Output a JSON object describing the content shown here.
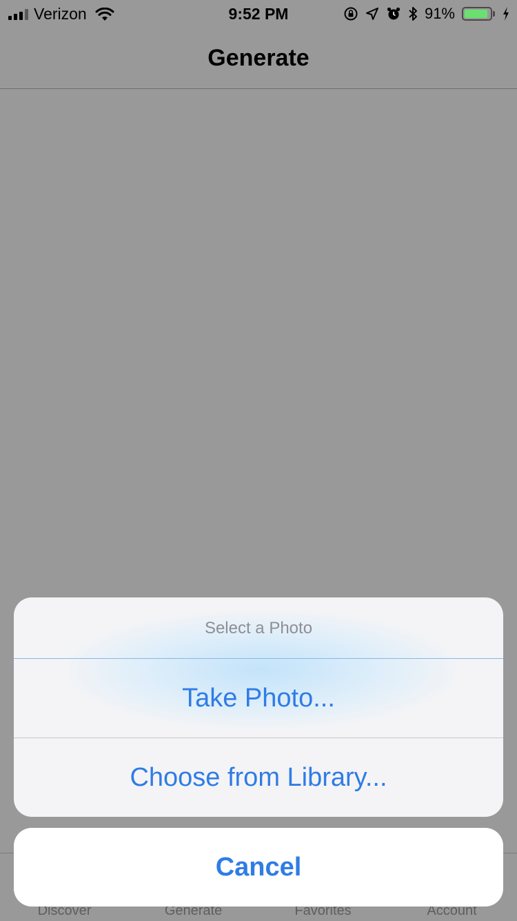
{
  "status_bar": {
    "carrier": "Verizon",
    "time": "9:52 PM",
    "battery_percent": "91%",
    "battery_level": 0.91,
    "icons": [
      "signal-icon",
      "wifi-icon",
      "orientation-lock-icon",
      "location-icon",
      "alarm-icon",
      "bluetooth-icon",
      "battery-icon",
      "charging-icon"
    ]
  },
  "nav": {
    "title": "Generate"
  },
  "action_sheet": {
    "title": "Select a Photo",
    "actions": [
      {
        "label": "Take Photo..."
      },
      {
        "label": "Choose from Library..."
      }
    ],
    "cancel_label": "Cancel"
  },
  "tab_bar": {
    "items": [
      {
        "label": "Discover"
      },
      {
        "label": "Generate"
      },
      {
        "label": "Favorites"
      },
      {
        "label": "Account"
      }
    ]
  },
  "colors": {
    "dim_background": "#999999",
    "action_blue": "#2f7ce6",
    "battery_green": "#69e070",
    "sheet_title_gray": "#8e8e93"
  }
}
